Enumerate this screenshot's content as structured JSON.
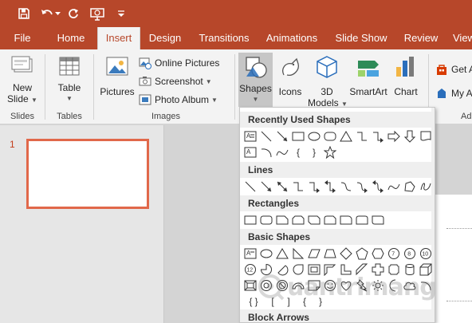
{
  "colors": {
    "accent": "#b7472a",
    "ribbon_bg": "#f3f3f3",
    "thumb_border": "#e1684a"
  },
  "quick_access": [
    "save-icon",
    "undo-icon",
    "undo-dropdown-icon",
    "repeat-icon",
    "present-from-beginning-icon",
    "customize-toolbar-icon"
  ],
  "tabs": [
    "File",
    "Home",
    "Insert",
    "Design",
    "Transitions",
    "Animations",
    "Slide Show",
    "Review",
    "View"
  ],
  "active_tab": "Insert",
  "ribbon": {
    "slides": {
      "new_slide_line1": "New",
      "new_slide_line2": "Slide",
      "group_label": "Slides"
    },
    "tables": {
      "table_label": "Table",
      "group_label": "Tables"
    },
    "images": {
      "pictures_label": "Pictures",
      "online_pictures": "Online Pictures",
      "screenshot": "Screenshot",
      "photo_album": "Photo Album",
      "group_label": "Images"
    },
    "illustrations": {
      "shapes_label": "Shapes",
      "icons_label": "Icons",
      "models_line1": "3D",
      "models_line2": "Models",
      "smartart_label": "SmartArt",
      "chart_label": "Chart"
    },
    "addins": {
      "get_addins": "Get A",
      "my_addins": "My A",
      "group_label": "Ad"
    }
  },
  "thumbnail": {
    "slide_number": "1"
  },
  "shapes_menu": {
    "categories": [
      "Recently Used Shapes",
      "Lines",
      "Rectangles",
      "Basic Shapes",
      "Block Arrows"
    ],
    "recent_braces": [
      "{",
      "}"
    ],
    "basic_numbers": [
      "6",
      "7",
      "8",
      "10",
      "12"
    ],
    "basic_brackets": [
      "{ }",
      "[",
      "]",
      "{",
      "}"
    ]
  },
  "watermark": {
    "text": "uantrimang"
  }
}
